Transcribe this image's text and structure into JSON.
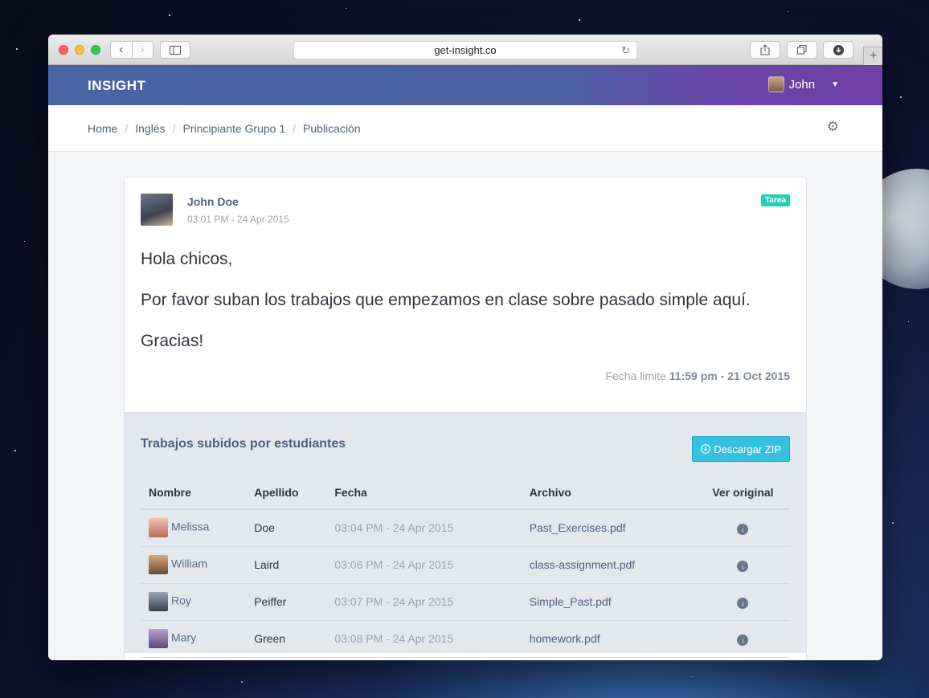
{
  "browser": {
    "url": "get-insight.co",
    "back_glyph": "‹",
    "forward_glyph": "›",
    "new_tab_glyph": "+"
  },
  "header": {
    "brand": "INSIGHT",
    "user_name": "John"
  },
  "breadcrumb": [
    "Home",
    "Inglés",
    "Principiante Grupo 1",
    "Publicación"
  ],
  "post": {
    "author": "John Doe",
    "time": "03:01 PM - 24 Apr 2015",
    "badge": "Tarea",
    "badge_color": "#1fd0b4",
    "paragraphs": [
      "Hola chicos,",
      "Por favor suban los trabajos que empezamos en clase sobre pasado simple aquí.",
      "Gracias!"
    ],
    "deadline_label": "Fecha limite",
    "deadline_value": "11:59 pm - 21 Oct 2015"
  },
  "uploads": {
    "title": "Trabajos subidos por estudiantes",
    "zip_button": "Descargar ZIP",
    "columns": [
      "Nombre",
      "Apellido",
      "Fecha",
      "Archivo",
      "Ver original"
    ],
    "rows": [
      {
        "first": "Melissa",
        "last": "Doe",
        "date": "03:04 PM - 24 Apr 2015",
        "file": "Past_Exercises.pdf"
      },
      {
        "first": "William",
        "last": "Laird",
        "date": "03:06 PM - 24 Apr 2015",
        "file": "class-assignment.pdf"
      },
      {
        "first": "Roy",
        "last": "Peiffer",
        "date": "03:07 PM - 24 Apr 2015",
        "file": "Simple_Past.pdf"
      },
      {
        "first": "Mary",
        "last": "Green",
        "date": "03:08 PM - 24 Apr 2015",
        "file": "homework.pdf"
      }
    ]
  },
  "icons": {
    "settings": "gear-icon",
    "download": "download-circle-icon"
  },
  "colors": {
    "nav_gradient_start": "#4a64a4",
    "nav_gradient_end": "#6f3fa6",
    "zip_button": "#35c1e0"
  }
}
